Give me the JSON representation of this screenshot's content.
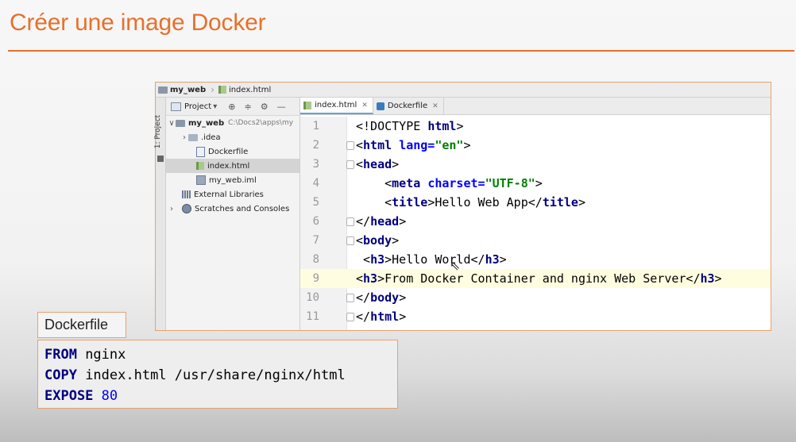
{
  "slide": {
    "title": "Créer une image Docker"
  },
  "ide": {
    "nav": {
      "project": "my_web",
      "file": "index.html"
    },
    "tool_strip": {
      "label": "1: Project"
    },
    "project_panel": {
      "title": "Project",
      "tree": [
        {
          "label": "my_web",
          "hint": "C:\\Docs2\\apps\\my"
        },
        {
          "label": ".idea"
        },
        {
          "label": "Dockerfile"
        },
        {
          "label": "index.html"
        },
        {
          "label": "my_web.iml"
        },
        {
          "label": "External Libraries"
        },
        {
          "label": "Scratches and Consoles"
        }
      ]
    },
    "tabs": [
      {
        "label": "index.html"
      },
      {
        "label": "Dockerfile"
      }
    ],
    "code_lines": [
      {
        "n": "1",
        "parts": [
          [
            "tx",
            "<!DOCTYPE "
          ],
          [
            "tg",
            "html"
          ],
          [
            "tx",
            ">"
          ]
        ]
      },
      {
        "n": "2",
        "parts": [
          [
            "tx",
            "<"
          ],
          [
            "tg",
            "html "
          ],
          [
            "at",
            "lang="
          ],
          [
            "st",
            "\"en\""
          ],
          [
            "tx",
            ">"
          ]
        ]
      },
      {
        "n": "3",
        "parts": [
          [
            "tx",
            "<"
          ],
          [
            "tg",
            "head"
          ],
          [
            "tx",
            ">"
          ]
        ]
      },
      {
        "n": "4",
        "parts": [
          [
            "tx",
            "    <"
          ],
          [
            "tg",
            "meta "
          ],
          [
            "at",
            "charset="
          ],
          [
            "st",
            "\"UTF-8\""
          ],
          [
            "tx",
            ">"
          ]
        ]
      },
      {
        "n": "5",
        "parts": [
          [
            "tx",
            "    <"
          ],
          [
            "tg",
            "title"
          ],
          [
            "tx",
            ">Hello Web App</"
          ],
          [
            "tg",
            "title"
          ],
          [
            "tx",
            ">"
          ]
        ]
      },
      {
        "n": "6",
        "parts": [
          [
            "tx",
            "</"
          ],
          [
            "tg",
            "head"
          ],
          [
            "tx",
            ">"
          ]
        ]
      },
      {
        "n": "7",
        "parts": [
          [
            "tx",
            "<"
          ],
          [
            "tg",
            "body"
          ],
          [
            "tx",
            ">"
          ]
        ]
      },
      {
        "n": "8",
        "parts": [
          [
            "tx",
            " <"
          ],
          [
            "tg",
            "h3"
          ],
          [
            "tx",
            ">Hello World</"
          ],
          [
            "tg",
            "h3"
          ],
          [
            "tx",
            ">"
          ]
        ]
      },
      {
        "n": "9",
        "parts": [
          [
            "tx",
            "<"
          ],
          [
            "tg",
            "h3"
          ],
          [
            "tx",
            ">From Docker Container and nginx Web Server</"
          ],
          [
            "tg",
            "h3"
          ],
          [
            "tx",
            ">"
          ]
        ]
      },
      {
        "n": "10",
        "parts": [
          [
            "tx",
            "</"
          ],
          [
            "tg",
            "body"
          ],
          [
            "tx",
            ">"
          ]
        ]
      },
      {
        "n": "11",
        "parts": [
          [
            "tx",
            "</"
          ],
          [
            "tg",
            "html"
          ],
          [
            "tx",
            ">"
          ]
        ]
      }
    ],
    "current_line": 9
  },
  "dockerfile": {
    "label": "Dockerfile",
    "lines": [
      {
        "keyword": "FROM",
        "rest": " nginx",
        "num": ""
      },
      {
        "keyword": "COPY",
        "rest": " index.html /usr/share/nginx/html",
        "num": ""
      },
      {
        "keyword": "EXPOSE",
        "rest": " ",
        "num": "80"
      }
    ]
  },
  "colors": {
    "accent": "#e8702a",
    "tag": "#000080",
    "attr": "#0000ff",
    "string": "#008000"
  }
}
